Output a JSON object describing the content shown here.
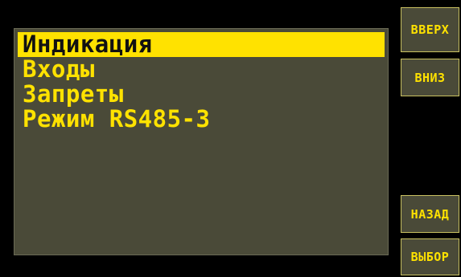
{
  "menu": {
    "items": [
      {
        "label": "Индикация",
        "selected": true
      },
      {
        "label": "Входы",
        "selected": false
      },
      {
        "label": "Запреты",
        "selected": false
      },
      {
        "label": "Режим RS485-3",
        "selected": false
      }
    ]
  },
  "softkeys": {
    "up": "ВВЕРХ",
    "down": "ВНИЗ",
    "back": "НАЗАД",
    "select": "ВЫБОР"
  },
  "colors": {
    "background": "#000000",
    "panel": "#4a4a38",
    "text": "#ffe200",
    "highlight": "#ffe200",
    "highlight_text": "#111111"
  }
}
